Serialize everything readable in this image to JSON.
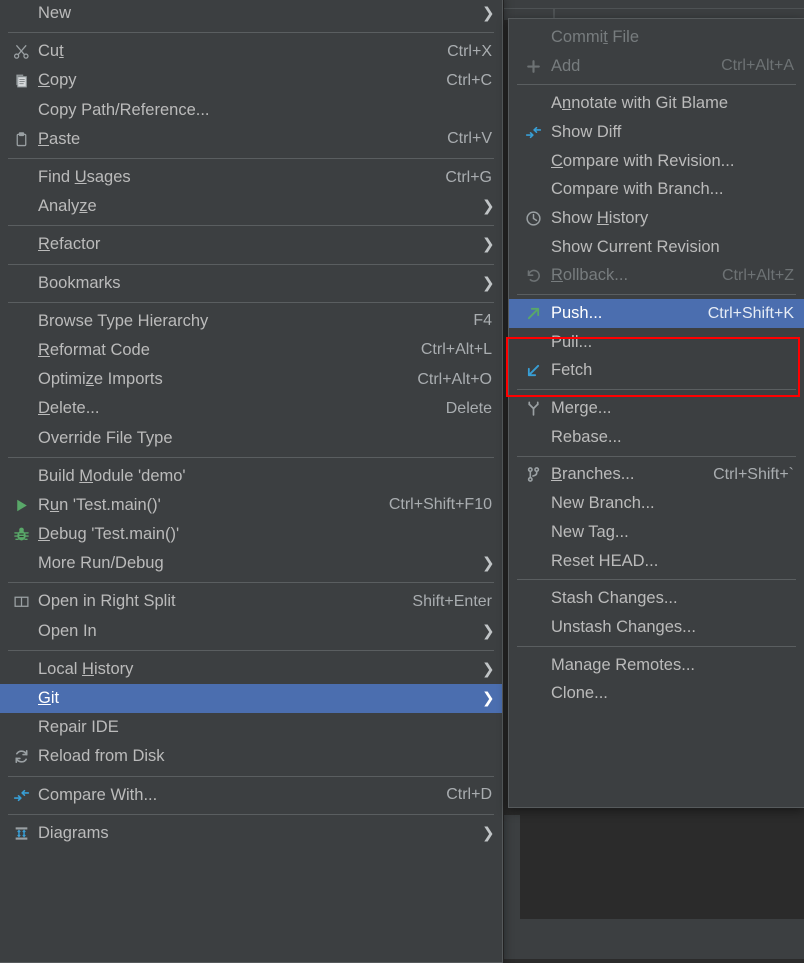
{
  "theme": {
    "menu_bg": "#3c3f41",
    "menu_border": "#565a5c",
    "text": "#bbbbbb",
    "text_disabled": "#777c7e",
    "selection_bg": "#4b6eaf",
    "selection_text": "#ffffff",
    "separator": "#5a5e60",
    "editor_bg": "#2b2b2b",
    "annotation_stroke": "#ff0000",
    "accent_green": "#59a869",
    "accent_blue": "#389fd6"
  },
  "context_menu": {
    "name": "editor-context-menu",
    "items": [
      {
        "type": "item",
        "label": "New",
        "icon": null,
        "accel": "",
        "submenu": true,
        "disabled": false,
        "selected": false,
        "mnemonic": ""
      },
      {
        "type": "separator"
      },
      {
        "type": "item",
        "label": "Cut",
        "icon": "scissors-icon",
        "accel": "Ctrl+X",
        "submenu": false,
        "disabled": false,
        "selected": false,
        "mnemonic": "t"
      },
      {
        "type": "item",
        "label": "Copy",
        "icon": "copy-icon",
        "accel": "Ctrl+C",
        "submenu": false,
        "disabled": false,
        "selected": false,
        "mnemonic": "C"
      },
      {
        "type": "item",
        "label": "Copy Path/Reference...",
        "icon": null,
        "accel": "",
        "submenu": false,
        "disabled": false,
        "selected": false,
        "mnemonic": ""
      },
      {
        "type": "item",
        "label": "Paste",
        "icon": "clipboard-icon",
        "accel": "Ctrl+V",
        "submenu": false,
        "disabled": false,
        "selected": false,
        "mnemonic": "P"
      },
      {
        "type": "separator"
      },
      {
        "type": "item",
        "label": "Find Usages",
        "icon": null,
        "accel": "Ctrl+G",
        "submenu": false,
        "disabled": false,
        "selected": false,
        "mnemonic": "U"
      },
      {
        "type": "item",
        "label": "Analyze",
        "icon": null,
        "accel": "",
        "submenu": true,
        "disabled": false,
        "selected": false,
        "mnemonic": "z"
      },
      {
        "type": "separator"
      },
      {
        "type": "item",
        "label": "Refactor",
        "icon": null,
        "accel": "",
        "submenu": true,
        "disabled": false,
        "selected": false,
        "mnemonic": "R"
      },
      {
        "type": "separator"
      },
      {
        "type": "item",
        "label": "Bookmarks",
        "icon": null,
        "accel": "",
        "submenu": true,
        "disabled": false,
        "selected": false,
        "mnemonic": ""
      },
      {
        "type": "separator"
      },
      {
        "type": "item",
        "label": "Browse Type Hierarchy",
        "icon": null,
        "accel": "F4",
        "submenu": false,
        "disabled": false,
        "selected": false,
        "mnemonic": ""
      },
      {
        "type": "item",
        "label": "Reformat Code",
        "icon": null,
        "accel": "Ctrl+Alt+L",
        "submenu": false,
        "disabled": false,
        "selected": false,
        "mnemonic": "R"
      },
      {
        "type": "item",
        "label": "Optimize Imports",
        "icon": null,
        "accel": "Ctrl+Alt+O",
        "submenu": false,
        "disabled": false,
        "selected": false,
        "mnemonic": "z"
      },
      {
        "type": "item",
        "label": "Delete...",
        "icon": null,
        "accel": "Delete",
        "submenu": false,
        "disabled": false,
        "selected": false,
        "mnemonic": "D"
      },
      {
        "type": "item",
        "label": "Override File Type",
        "icon": null,
        "accel": "",
        "submenu": false,
        "disabled": false,
        "selected": false,
        "mnemonic": ""
      },
      {
        "type": "separator"
      },
      {
        "type": "item",
        "label": "Build Module 'demo'",
        "icon": null,
        "accel": "",
        "submenu": false,
        "disabled": false,
        "selected": false,
        "mnemonic": "M"
      },
      {
        "type": "item",
        "label": "Run 'Test.main()'",
        "icon": "run-icon",
        "accel": "Ctrl+Shift+F10",
        "submenu": false,
        "disabled": false,
        "selected": false,
        "mnemonic": "u"
      },
      {
        "type": "item",
        "label": "Debug 'Test.main()'",
        "icon": "debug-icon",
        "accel": "",
        "submenu": false,
        "disabled": false,
        "selected": false,
        "mnemonic": "D"
      },
      {
        "type": "item",
        "label": "More Run/Debug",
        "icon": null,
        "accel": "",
        "submenu": true,
        "disabled": false,
        "selected": false,
        "mnemonic": ""
      },
      {
        "type": "separator"
      },
      {
        "type": "item",
        "label": "Open in Right Split",
        "icon": "split-icon",
        "accel": "Shift+Enter",
        "submenu": false,
        "disabled": false,
        "selected": false,
        "mnemonic": ""
      },
      {
        "type": "item",
        "label": "Open In",
        "icon": null,
        "accel": "",
        "submenu": true,
        "disabled": false,
        "selected": false,
        "mnemonic": ""
      },
      {
        "type": "separator"
      },
      {
        "type": "item",
        "label": "Local History",
        "icon": null,
        "accel": "",
        "submenu": true,
        "disabled": false,
        "selected": false,
        "mnemonic": "H"
      },
      {
        "type": "item",
        "label": "Git",
        "icon": null,
        "accel": "",
        "submenu": true,
        "disabled": false,
        "selected": true,
        "mnemonic": "G"
      },
      {
        "type": "item",
        "label": "Repair IDE",
        "icon": null,
        "accel": "",
        "submenu": false,
        "disabled": false,
        "selected": false,
        "mnemonic": ""
      },
      {
        "type": "item",
        "label": "Reload from Disk",
        "icon": "reload-icon",
        "accel": "",
        "submenu": false,
        "disabled": false,
        "selected": false,
        "mnemonic": ""
      },
      {
        "type": "separator"
      },
      {
        "type": "item",
        "label": "Compare With...",
        "icon": "diff-icon",
        "accel": "Ctrl+D",
        "submenu": false,
        "disabled": false,
        "selected": false,
        "mnemonic": ""
      },
      {
        "type": "separator"
      },
      {
        "type": "item",
        "label": "Diagrams",
        "icon": "diagram-icon",
        "accel": "",
        "submenu": true,
        "disabled": false,
        "selected": false,
        "mnemonic": ""
      }
    ]
  },
  "git_submenu": {
    "name": "git-submenu",
    "items": [
      {
        "type": "item",
        "label": "Commit File",
        "icon": null,
        "accel": "",
        "submenu": false,
        "disabled": true,
        "selected": false,
        "mnemonic": "t"
      },
      {
        "type": "item",
        "label": "Add",
        "icon": "plus-icon",
        "accel": "Ctrl+Alt+A",
        "submenu": false,
        "disabled": true,
        "selected": false,
        "mnemonic": ""
      },
      {
        "type": "separator"
      },
      {
        "type": "item",
        "label": "Annotate with Git Blame",
        "icon": null,
        "accel": "",
        "submenu": false,
        "disabled": false,
        "selected": false,
        "mnemonic": "n"
      },
      {
        "type": "item",
        "label": "Show Diff",
        "icon": "diff-icon",
        "accel": "",
        "submenu": false,
        "disabled": false,
        "selected": false,
        "mnemonic": ""
      },
      {
        "type": "item",
        "label": "Compare with Revision...",
        "icon": null,
        "accel": "",
        "submenu": false,
        "disabled": false,
        "selected": false,
        "mnemonic": "C"
      },
      {
        "type": "item",
        "label": "Compare with Branch...",
        "icon": null,
        "accel": "",
        "submenu": false,
        "disabled": false,
        "selected": false,
        "mnemonic": ""
      },
      {
        "type": "item",
        "label": "Show History",
        "icon": "history-icon",
        "accel": "",
        "submenu": false,
        "disabled": false,
        "selected": false,
        "mnemonic": "H"
      },
      {
        "type": "item",
        "label": "Show Current Revision",
        "icon": null,
        "accel": "",
        "submenu": false,
        "disabled": false,
        "selected": false,
        "mnemonic": ""
      },
      {
        "type": "item",
        "label": "Rollback...",
        "icon": "rollback-icon",
        "accel": "Ctrl+Alt+Z",
        "submenu": false,
        "disabled": true,
        "selected": false,
        "mnemonic": "R"
      },
      {
        "type": "separator"
      },
      {
        "type": "item",
        "label": "Push...",
        "icon": "push-icon",
        "accel": "Ctrl+Shift+K",
        "submenu": false,
        "disabled": false,
        "selected": true,
        "mnemonic": ""
      },
      {
        "type": "item",
        "label": "Pull...",
        "icon": null,
        "accel": "",
        "submenu": false,
        "disabled": false,
        "selected": false,
        "mnemonic": ""
      },
      {
        "type": "item",
        "label": "Fetch",
        "icon": "fetch-icon",
        "accel": "",
        "submenu": false,
        "disabled": false,
        "selected": false,
        "mnemonic": ""
      },
      {
        "type": "separator"
      },
      {
        "type": "item",
        "label": "Merge...",
        "icon": "merge-icon",
        "accel": "",
        "submenu": false,
        "disabled": false,
        "selected": false,
        "mnemonic": ""
      },
      {
        "type": "item",
        "label": "Rebase...",
        "icon": null,
        "accel": "",
        "submenu": false,
        "disabled": false,
        "selected": false,
        "mnemonic": ""
      },
      {
        "type": "separator"
      },
      {
        "type": "item",
        "label": "Branches...",
        "icon": "branch-icon",
        "accel": "Ctrl+Shift+`",
        "submenu": false,
        "disabled": false,
        "selected": false,
        "mnemonic": "B"
      },
      {
        "type": "item",
        "label": "New Branch...",
        "icon": null,
        "accel": "",
        "submenu": false,
        "disabled": false,
        "selected": false,
        "mnemonic": ""
      },
      {
        "type": "item",
        "label": "New Tag...",
        "icon": null,
        "accel": "",
        "submenu": false,
        "disabled": false,
        "selected": false,
        "mnemonic": ""
      },
      {
        "type": "item",
        "label": "Reset HEAD...",
        "icon": null,
        "accel": "",
        "submenu": false,
        "disabled": false,
        "selected": false,
        "mnemonic": ""
      },
      {
        "type": "separator"
      },
      {
        "type": "item",
        "label": "Stash Changes...",
        "icon": null,
        "accel": "",
        "submenu": false,
        "disabled": false,
        "selected": false,
        "mnemonic": ""
      },
      {
        "type": "item",
        "label": "Unstash Changes...",
        "icon": null,
        "accel": "",
        "submenu": false,
        "disabled": false,
        "selected": false,
        "mnemonic": ""
      },
      {
        "type": "separator"
      },
      {
        "type": "item",
        "label": "Manage Remotes...",
        "icon": null,
        "accel": "",
        "submenu": false,
        "disabled": false,
        "selected": false,
        "mnemonic": ""
      },
      {
        "type": "item",
        "label": "Clone...",
        "icon": null,
        "accel": "",
        "submenu": false,
        "disabled": false,
        "selected": false,
        "mnemonic": ""
      }
    ]
  },
  "annotation": {
    "name": "push-pull-highlight-box",
    "shape": "rectangle",
    "color": "#ff0000",
    "covers": [
      "Push...",
      "Pull..."
    ]
  }
}
